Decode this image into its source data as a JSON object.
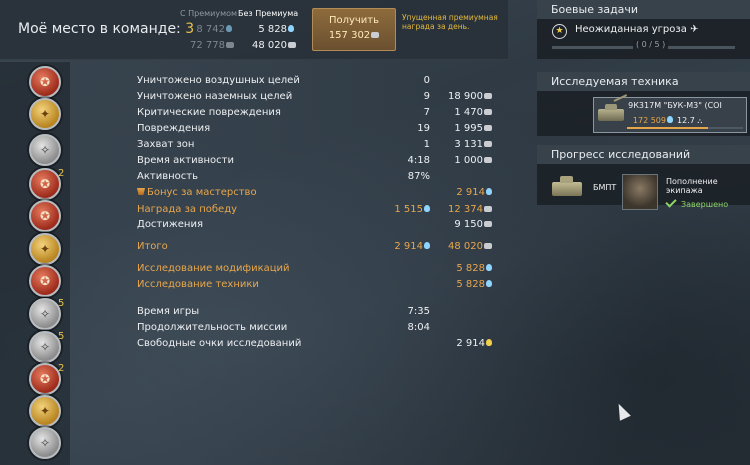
{
  "header": {
    "team_place_label": "Моё место в команде:",
    "team_place_value": "3",
    "col_premium": "С Премиумом",
    "col_no_premium": "Без Премиума",
    "premium_rp": "8 742",
    "premium_sl": "72 778",
    "no_premium_rp": "5 828",
    "no_premium_sl": "48 020",
    "get_button_label": "Получить",
    "get_button_amount": "157 302",
    "missed_reward_text": "Упущенная премиумная награда за день."
  },
  "medals": {
    "items": [
      {
        "icon": "aircraft-medal",
        "style": "red",
        "mult": ""
      },
      {
        "icon": "soldier-medal",
        "style": "gold",
        "mult": ""
      },
      {
        "icon": "helmet-medal",
        "style": "silver",
        "mult": ""
      },
      {
        "icon": "cross-medal",
        "style": "red",
        "mult": "2"
      },
      {
        "icon": "star-medal",
        "style": "red",
        "mult": ""
      },
      {
        "icon": "laurel-medal",
        "style": "gold",
        "mult": ""
      },
      {
        "icon": "shield-medal",
        "style": "red",
        "mult": ""
      },
      {
        "icon": "bomb-medal",
        "style": "silver",
        "mult": "5"
      },
      {
        "icon": "swords-medal",
        "style": "silver",
        "mult": "5"
      },
      {
        "icon": "cross-medal-2",
        "style": "red",
        "mult": "2"
      },
      {
        "icon": "badge-medal",
        "style": "gold",
        "mult": ""
      },
      {
        "icon": "wings-medal",
        "style": "silver",
        "mult": ""
      }
    ]
  },
  "stats": {
    "rows": [
      {
        "label": "Уничтожено воздушных целей",
        "v1": "0",
        "v2": "",
        "v2_icon": "",
        "style": ""
      },
      {
        "label": "Уничтожено наземных целей",
        "v1": "9",
        "v2": "18 900",
        "v2_icon": "sl",
        "style": ""
      },
      {
        "label": "Критические повреждения",
        "v1": "7",
        "v2": "1 470",
        "v2_icon": "sl",
        "style": ""
      },
      {
        "label": "Повреждения",
        "v1": "19",
        "v2": "1 995",
        "v2_icon": "sl",
        "style": ""
      },
      {
        "label": "Захват зон",
        "v1": "1",
        "v2": "3 131",
        "v2_icon": "sl",
        "style": ""
      },
      {
        "label": "Время активности",
        "v1": "4:18",
        "v2": "1 000",
        "v2_icon": "sl",
        "style": ""
      },
      {
        "label": "Активность",
        "v1": "87%",
        "v2": "",
        "v2_icon": "",
        "style": ""
      },
      {
        "label": "Бонус за мастерство",
        "v1": "",
        "v2": "2 914",
        "v2_icon": "rp",
        "style": "orange",
        "bonus": true
      },
      {
        "label": "Награда за победу",
        "v1": "1 515",
        "v1_icon": "rp",
        "v2": "12 374",
        "v2_icon": "sl",
        "style": "orange"
      },
      {
        "label": "Достижения",
        "v1": "",
        "v2": "9 150",
        "v2_icon": "sl",
        "style": ""
      }
    ],
    "total": {
      "label": "Итого",
      "v1": "2 914",
      "v2": "48 020"
    },
    "research_rows": [
      {
        "label": "Исследование модификаций",
        "v2": "5 828"
      },
      {
        "label": "Исследование техники",
        "v2": "5 828"
      }
    ],
    "extra_rows": [
      {
        "label": "Время игры",
        "v1": "7:35",
        "v2": ""
      },
      {
        "label": "Продолжительность миссии",
        "v1": "8:04",
        "v2": ""
      },
      {
        "label": "Свободные очки исследований",
        "v1": "",
        "v2": "2 914"
      }
    ]
  },
  "missions": {
    "title": "Боевые задачи",
    "task_name": "Неожиданная угроза",
    "task_progress": "( 0 / 5 )",
    "task_fraction": 0
  },
  "vehicle": {
    "title": "Исследуемая техника",
    "name": "9К317М \"БУК-М3\" (СОІ",
    "progress": "172 509",
    "br": "12.7",
    "progress_fraction": 0.7
  },
  "research": {
    "title": "Прогресс исследований",
    "unit": "БМПТ",
    "crew_title": "Пополнение экипажа",
    "status": "Завершено"
  },
  "colors": {
    "accent_gold": "#e7c24a",
    "accent_orange": "#e8a64b",
    "rp_blue": "#8fd4ff",
    "done_green": "#8fd56a"
  }
}
